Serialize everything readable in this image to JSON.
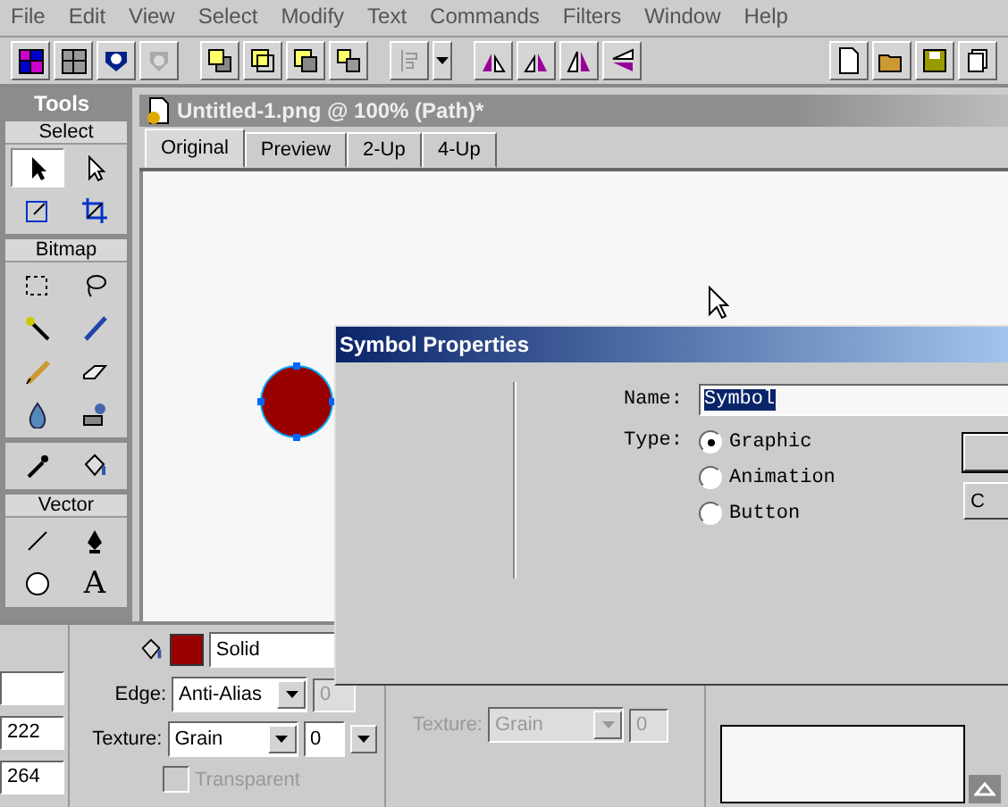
{
  "menu": [
    "File",
    "Edit",
    "View",
    "Select",
    "Modify",
    "Text",
    "Commands",
    "Filters",
    "Window",
    "Help"
  ],
  "tools": {
    "title": "Tools",
    "sections": [
      {
        "label": "Select",
        "tools": [
          {
            "kind": "pointer",
            "selected": true
          },
          {
            "kind": "subselect",
            "selected": false
          },
          {
            "kind": "scale",
            "selected": false
          },
          {
            "kind": "crop",
            "selected": false
          }
        ]
      },
      {
        "label": "Bitmap",
        "tools": [
          {
            "kind": "marquee",
            "selected": false
          },
          {
            "kind": "lasso",
            "selected": false
          },
          {
            "kind": "wand",
            "selected": false
          },
          {
            "kind": "brush",
            "selected": false
          },
          {
            "kind": "pencil",
            "selected": false
          },
          {
            "kind": "eraser",
            "selected": false
          },
          {
            "kind": "drop",
            "selected": false
          },
          {
            "kind": "stamp",
            "selected": false
          }
        ]
      },
      {
        "tools": [
          {
            "kind": "eyedropper",
            "selected": false
          },
          {
            "kind": "bucket",
            "selected": false
          }
        ]
      },
      {
        "label": "Vector",
        "tools": [
          {
            "kind": "line",
            "selected": false
          },
          {
            "kind": "pen",
            "selected": false
          },
          {
            "kind": "ellipse",
            "selected": false
          },
          {
            "kind": "text",
            "glyph": "A",
            "selected": false
          }
        ]
      }
    ]
  },
  "document": {
    "title": "Untitled-1.png @  100% (Path)*",
    "tabs": [
      {
        "label": "Original",
        "selected": true
      },
      {
        "label": "Preview",
        "selected": false
      },
      {
        "label": "2-Up",
        "selected": false
      },
      {
        "label": "4-Up",
        "selected": false
      }
    ]
  },
  "dialog": {
    "title": "Symbol Properties",
    "name_label": "Name:",
    "name_value": "Symbol",
    "type_label": "Type:",
    "types": [
      {
        "label": "Graphic",
        "selected": true
      },
      {
        "label": "Animation",
        "selected": false
      },
      {
        "label": "Button",
        "selected": false
      }
    ],
    "buttons": [
      {
        "is_default": true
      },
      {
        "label": "C",
        "is_default": false
      }
    ]
  },
  "properties": {
    "fields": [
      "222",
      "264"
    ],
    "fill": {
      "color": "#990000",
      "fill_type": "Solid",
      "edge_label": "Edge:",
      "edge": "Anti-Alias",
      "edge_amount": "0",
      "texture_label": "Texture:",
      "texture": "Grain",
      "texture_amount": "0",
      "transparent": {
        "label": "Transparent",
        "checked": false,
        "disabled": true
      }
    },
    "stroke": {
      "texture_label": "Texture:",
      "texture": "Grain",
      "texture_amount": "0",
      "disabled": true
    }
  }
}
